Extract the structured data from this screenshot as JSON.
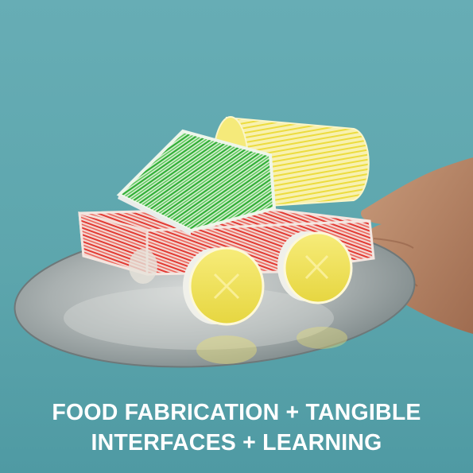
{
  "caption": {
    "line1": "FOOD FABRICATION + TANGIBLE",
    "line2": "INTERFACES + LEARNING"
  },
  "colors": {
    "background": "#5fa6ad",
    "caption_text": "#ffffff",
    "truck_body": "#e5433b",
    "truck_cab": "#3fb83f",
    "truck_tank": "#f3e35a",
    "wheels": "#f2e64a",
    "plate": "#b8bcbc"
  }
}
